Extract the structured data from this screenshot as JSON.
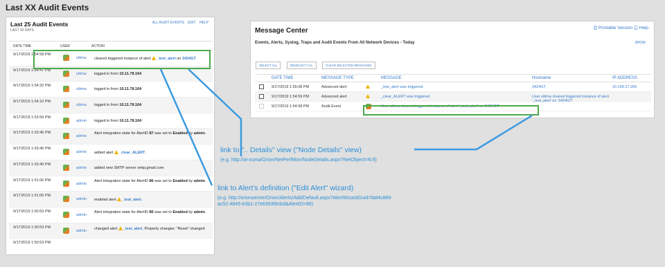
{
  "page_heading": "Last XX Audit Events",
  "audit_panel": {
    "title": "Last 25 Audit Events",
    "subtitle": "LAST 30 DAYS",
    "links": [
      "ALL AUDIT EVENTS",
      "EDIT",
      "HELP"
    ],
    "columns": [
      "DATE TIME",
      "USER",
      "ACTION"
    ],
    "rows": [
      {
        "time": "9/17/2019 1:54:58 PM",
        "user": "ultima",
        "a1": "cleared triggered instance of alert ",
        "link1": "_test_alert",
        "a2": " on ",
        "link2": "3424GT",
        "a3": ""
      },
      {
        "time": "9/17/2019 1:54:47 PM",
        "user": "ultima",
        "a1": "logged in from ",
        "bold1": "10.11.78.164"
      },
      {
        "time": "9/17/2019 1:54:32 PM",
        "user": "ultima",
        "a1": "logged in from ",
        "bold1": "10.11.78.164"
      },
      {
        "time": "9/17/2019 1:54:10 PM",
        "user": "ultima",
        "a1": "logged in from ",
        "bold1": "10.11.78.164"
      },
      {
        "time": "9/17/2019 1:53:59 PM",
        "user": "admin",
        "a1": "logged in from ",
        "bold1": "10.11.78.164"
      },
      {
        "time": "9/17/2019 1:53:46 PM",
        "user": "admin",
        "a1": "Alert integration state for AlertID ",
        "bold1": "87",
        "a2": " was set to ",
        "bold2": "Enabled",
        "a3": " by ",
        "bold3": "admin",
        "a4": "."
      },
      {
        "time": "9/17/2019 1:53:46 PM",
        "user": "admin",
        "a1": "added alert ",
        "link1": "_clear_ALERT",
        "a2": "."
      },
      {
        "time": "9/17/2019 1:53:40 PM",
        "user": "admin",
        "a1": "added new SMTP server smtp.gmail.com"
      },
      {
        "time": "9/17/2019 1:51:06 PM",
        "user": "admin",
        "a1": "Alert integration state for AlertID ",
        "bold1": "86",
        "a2": " was set to ",
        "bold2": "Enabled",
        "a3": " by ",
        "bold3": "admin",
        "a4": "."
      },
      {
        "time": "9/17/2019 1:51:06 PM",
        "user": "admin",
        "a1": "enabled alert ",
        "link1": "_test_alert",
        "a2": "."
      },
      {
        "time": "9/17/2019 1:50:53 PM",
        "user": "admin",
        "a1": "Alert integration state for AlertID ",
        "bold1": "86",
        "a2": " was set to ",
        "bold2": "Enabled",
        "a3": " by ",
        "bold3": "admin",
        "a4": "."
      },
      {
        "time": "9/17/2019 1:50:53 PM",
        "user": "admin",
        "a1": "changed alert ",
        "link1": "_test_alert",
        "a2": ". Property changes: \"Reset\" changed"
      },
      {
        "time": "9/17/2019 1:50:53 PM",
        "user": "",
        "a1": ""
      }
    ]
  },
  "message_center": {
    "title": "Message Center",
    "printable": "Printable Version",
    "help": "Help",
    "subtitle": "Events, Alerts, Syslog, Traps and Audit Events From All Network Devices - Today",
    "show": "SHOW",
    "buttons": [
      "SELECT ALL",
      "DESELECT ALL",
      "CLEAR SELECTED MESSAGES"
    ],
    "columns": [
      "DATE TIME",
      "MESSAGE TYPE",
      "MESSAGE",
      "Hostname",
      "IP ADDRESS"
    ],
    "rows": [
      {
        "time": "9/17/2019 1:55:08 PM",
        "type": "Advanced alert",
        "icon": "warning-icon",
        "message": "_test_alert was triggered.",
        "hostname": "3424GT",
        "ip": "10.199.17.206"
      },
      {
        "time": "9/17/2019 1:54:59 PM",
        "type": "Advanced alert",
        "icon": "warning-icon",
        "message": "_clear_ALERT was triggered.",
        "hostname": "User ultima cleared triggered instance of alert '_test_alert' on '3424GT'",
        "ip": ""
      },
      {
        "time": "9/17/2019 1:54:58 PM",
        "type": "Audit Event",
        "icon": "user-avatar-icon",
        "message": "User ultima cleared triggered instance of alert '_test_alert' on '3424GT'",
        "hostname": "",
        "ip": ""
      }
    ]
  },
  "annotations": {
    "details_title": "link to \".. Details\" view (\"Node Details\" view)",
    "details_sub": "(e.g. http://ai-zuma/Orion/NetPerfMon/NodeDetails.aspx?NetObject=N:9)",
    "alert_title": "link to Alert's definition (\"Edit Alert\" wizard)",
    "alert_sub_1": "(e.g. http://orionserver/Orion/Alerts/Add/Default.aspx?AlertWizardGuid=fa84c866-",
    "alert_sub_2": "ac52-4845-b3b1-27e6393f9cbd&AlertID=86)"
  },
  "colors": {
    "highlight": "#4aa84a",
    "annotation": "#2a8fd6",
    "link": "#3579c8"
  }
}
